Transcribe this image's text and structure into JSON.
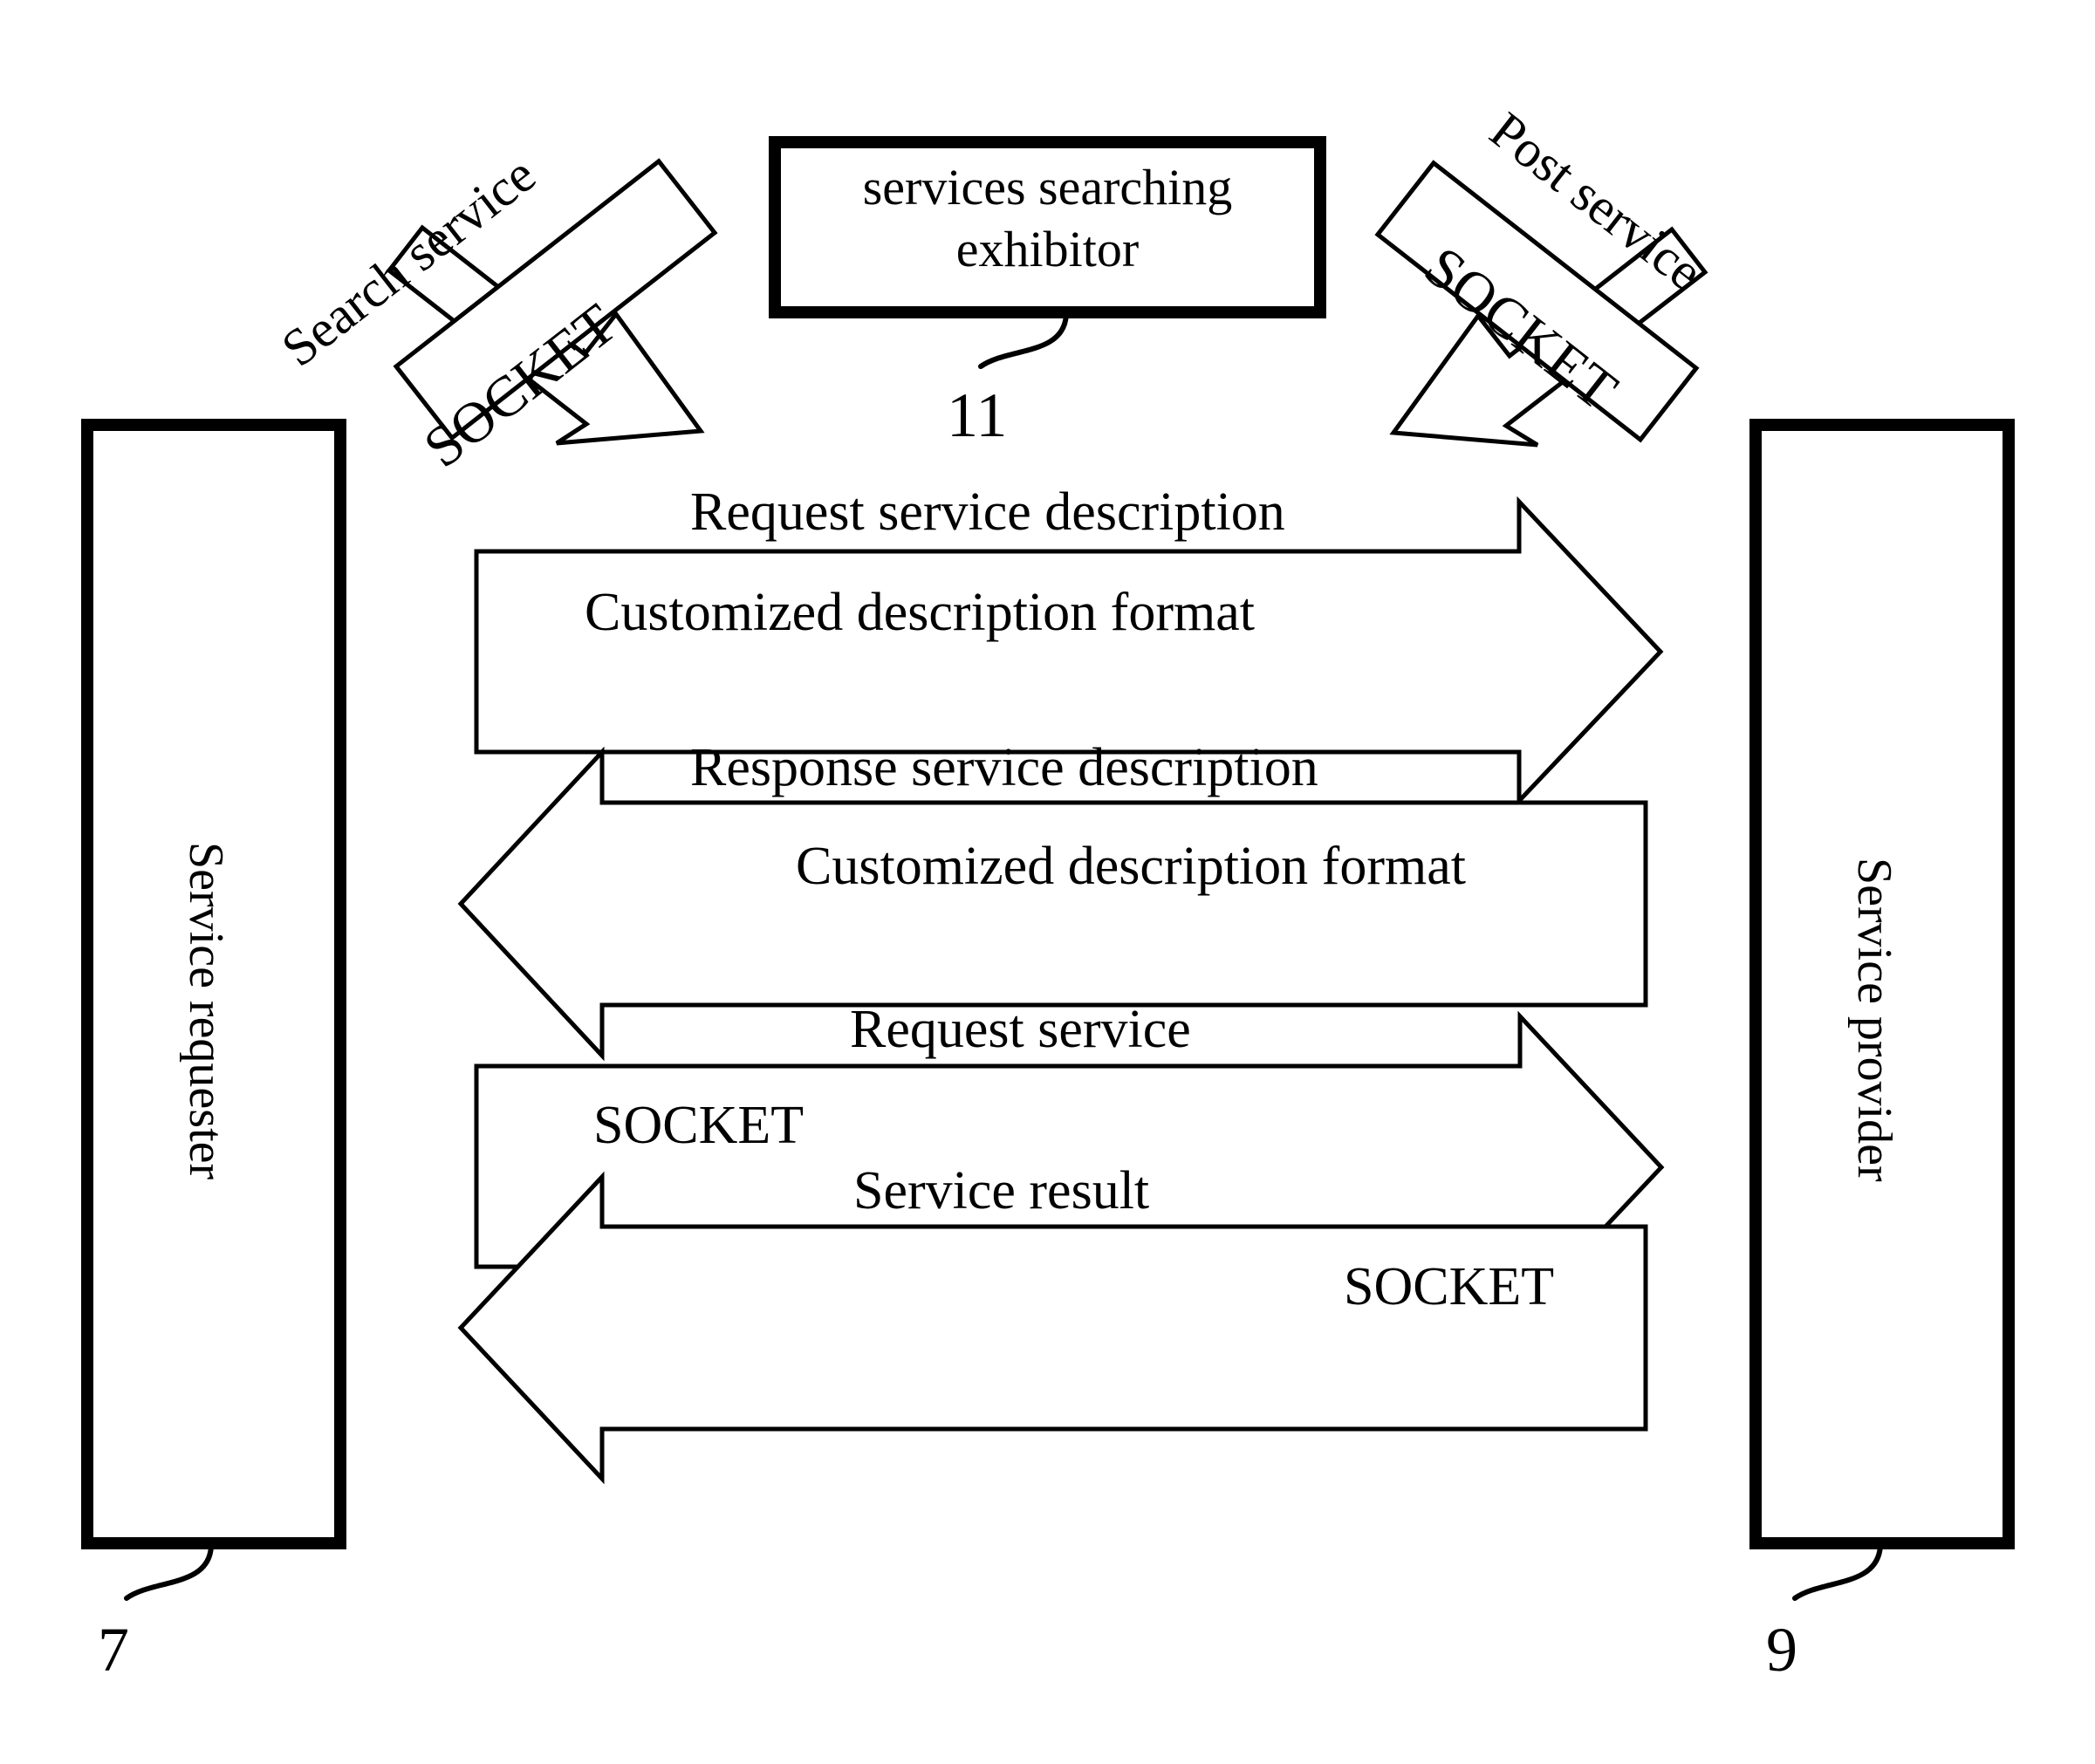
{
  "figure": {
    "type": "patent-diagram",
    "background_color": "#ffffff",
    "line_color": "#000000"
  },
  "nodes": {
    "requester": {
      "label": "Service requester",
      "ref": "7"
    },
    "provider": {
      "label": "Service provider",
      "ref": "9"
    },
    "exhibitor": {
      "label": "services searching\nexhibitor",
      "ref": "11"
    }
  },
  "diagonal_arrows": [
    {
      "name": "search-service",
      "caption": "Search service",
      "protocol": "SOCKET",
      "direction": "up-right"
    },
    {
      "name": "post-service",
      "caption": "Post service",
      "protocol": "SOCKET",
      "direction": "up-left"
    }
  ],
  "horizontal_arrows": [
    {
      "name": "request-service-description",
      "title": "Request service description",
      "body": "Customized description format",
      "direction": "right",
      "body_align": "center"
    },
    {
      "name": "response-service-description",
      "title": "Response service description",
      "body": "Customized description format",
      "direction": "left",
      "body_align": "center"
    },
    {
      "name": "request-service",
      "title": "Request service",
      "body": "SOCKET",
      "direction": "right",
      "body_align": "left"
    },
    {
      "name": "service-result",
      "title": "Service result",
      "body": "SOCKET",
      "direction": "left",
      "body_align": "right"
    }
  ]
}
